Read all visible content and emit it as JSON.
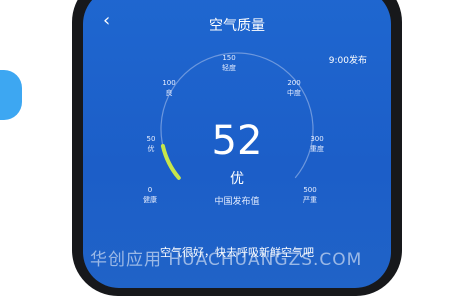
{
  "header": {
    "back_icon": "chevron-left-icon",
    "title": "空气质量"
  },
  "publish_time": "9:00发布",
  "gauge": {
    "value": "52",
    "level": "优",
    "source": "中国发布值",
    "max": 500,
    "progress_color": "#c6e64b",
    "ticks": [
      {
        "num": "0",
        "label": "健康"
      },
      {
        "num": "50",
        "label": "优"
      },
      {
        "num": "100",
        "label": "良"
      },
      {
        "num": "150",
        "label": "轻度"
      },
      {
        "num": "200",
        "label": "中度"
      },
      {
        "num": "300",
        "label": "重度"
      },
      {
        "num": "500",
        "label": "严重"
      }
    ]
  },
  "advice": "空气很好，快去呼吸新鲜空气吧",
  "watermark": "华创应用 HUACHUANGZS.COM"
}
